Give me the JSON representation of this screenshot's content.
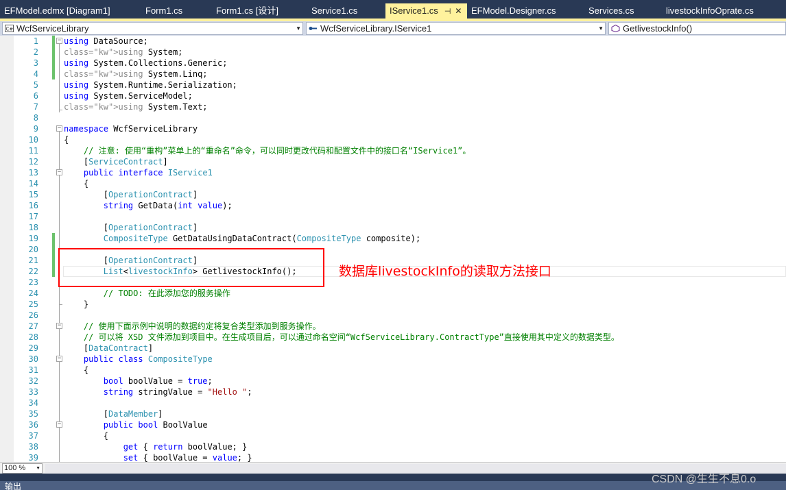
{
  "tabs": [
    {
      "label": "EFModel.edmx [Diagram1]",
      "active": false
    },
    {
      "label": "Form1.cs",
      "active": false
    },
    {
      "label": "Form1.cs [设计]",
      "active": false
    },
    {
      "label": "Service1.cs",
      "active": false
    },
    {
      "label": "IService1.cs",
      "active": true,
      "pin_icon": "pin-icon",
      "close_icon": "close-icon"
    },
    {
      "label": "EFModel.Designer.cs",
      "active": false
    },
    {
      "label": "Services.cs",
      "active": false
    },
    {
      "label": "livestockInfoOprate.cs",
      "active": false
    }
  ],
  "navbar": {
    "project": "WcfServiceLibrary",
    "type": "WcfServiceLibrary.IService1",
    "member": "GetlivestockInfo()"
  },
  "code": {
    "line_numbers": [
      "1",
      "2",
      "3",
      "4",
      "5",
      "6",
      "7",
      "8",
      "9",
      "10",
      "11",
      "12",
      "13",
      "14",
      "15",
      "16",
      "17",
      "18",
      "19",
      "20",
      "21",
      "22",
      "23",
      "24",
      "25",
      "26",
      "27",
      "28",
      "29",
      "30",
      "31",
      "32",
      "33",
      "34",
      "35",
      "36",
      "37",
      "38",
      "39"
    ],
    "lines": [
      "using DataSource;",
      "using System;",
      "using System.Collections.Generic;",
      "using System.Linq;",
      "using System.Runtime.Serialization;",
      "using System.ServiceModel;",
      "using System.Text;",
      "",
      "namespace WcfServiceLibrary",
      "{",
      "    // 注意: 使用“重构”菜单上的“重命名”命令，可以同时更改代码和配置文件中的接口名“IService1”。",
      "    [ServiceContract]",
      "    public interface IService1",
      "    {",
      "        [OperationContract]",
      "        string GetData(int value);",
      "",
      "        [OperationContract]",
      "        CompositeType GetDataUsingDataContract(CompositeType composite);",
      "",
      "        [OperationContract]",
      "        List<livestockInfo> GetlivestockInfo();",
      "",
      "        // TODO: 在此添加您的服务操作",
      "    }",
      "",
      "    // 使用下面示例中说明的数据约定将复合类型添加到服务操作。",
      "    // 可以将 XSD 文件添加到项目中。在生成项目后，可以通过命名空间“WcfServiceLibrary.ContractType”直接使用其中定义的数据类型。",
      "    [DataContract]",
      "    public class CompositeType",
      "    {",
      "        bool boolValue = true;",
      "        string stringValue = \"Hello \";",
      "",
      "        [DataMember]",
      "        public bool BoolValue",
      "        {",
      "            get { return boolValue; }",
      "            set { boolValue = value; }"
    ]
  },
  "annotation": "数据库livestockInfo的读取方法接口",
  "zoom": "100 %",
  "output_title": "输出",
  "watermark": "CSDN @生生不息0.o",
  "colors": {
    "tab_strip": "#293955",
    "active_tab": "#fff29d",
    "keyword": "#0000ff",
    "type": "#2b91af",
    "comment": "#008000",
    "string": "#a31515",
    "line_number": "#2b91af",
    "changed_marker": "#6cc26c",
    "annotation": "#ff0000"
  }
}
